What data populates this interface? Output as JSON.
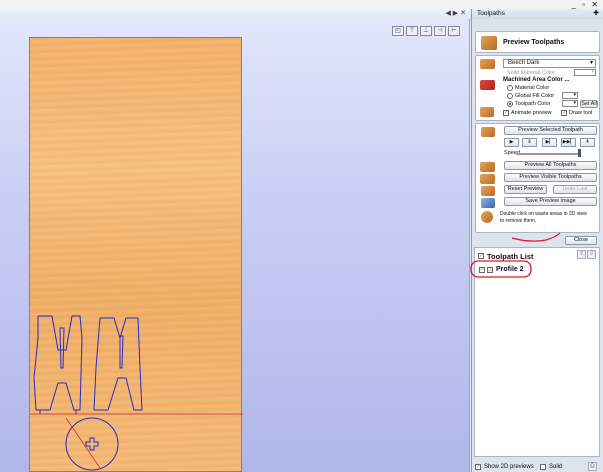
{
  "window": {
    "controls": "_ ▫ ✕"
  },
  "view": {
    "tab_controls": "◀ ▶ ✕",
    "toolbar_icons": [
      "iso-view-icon",
      "top-view-icon",
      "front-view-icon",
      "left-view-icon",
      "right-view-icon"
    ],
    "toolbar_glyphs": [
      "◰",
      "⊤",
      "⊥",
      "⊣",
      "⊢"
    ]
  },
  "panel": {
    "title": "Toolpaths",
    "pin": "✚",
    "preview_title": "Preview Toolpaths",
    "material_select": "Beech Dark",
    "solid_material_color_label": "Solid Material Color",
    "machined_area_label": "Machined Area Color ...",
    "material_color_label": "Material Color",
    "global_fill_label": "Global Fill Color",
    "toolpath_color_label": "Toolpath Color",
    "set_all_label": "Set All",
    "animate_label": "Animate preview",
    "draw_tool_label": "Draw tool",
    "preview_selected_label": "Preview Selected Toolpath",
    "speed_label": "Speed",
    "preview_all_label": "Preview All Toolpaths",
    "preview_visible_label": "Preview Visible Toolpaths",
    "reset_preview_label": "Reset Preview",
    "undo_last_label": "Undo Last",
    "save_preview_label": "Save Preview Image",
    "hint_text_1": "Double click on waste areas in 3D view",
    "hint_text_2": "to remove them.",
    "close_label": "Close",
    "play_glyphs": [
      "▶",
      "Ⅱ",
      "▶▏",
      "▶▶▏",
      "⇞"
    ]
  },
  "toolpath_list": {
    "title": "Toolpath List",
    "items": [
      {
        "label": "Profile 2",
        "checked": true
      }
    ]
  },
  "bottom": {
    "show_2d_label": "Show 2D previews",
    "solid_label": "Solid"
  },
  "colors": {
    "toolpath_line": "#2a2ac8",
    "annotation": "#e0161e",
    "material": "#f2b06a"
  }
}
